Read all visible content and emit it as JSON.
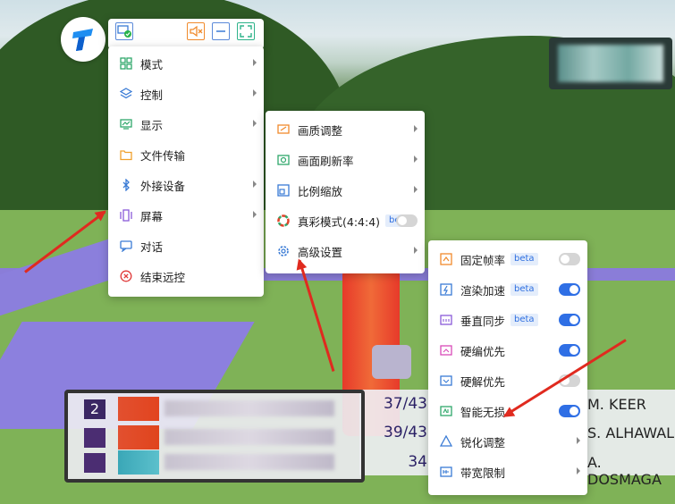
{
  "toolbar": {
    "icons": [
      "screen-check-icon",
      "mute-speaker-icon",
      "minimize-icon",
      "fullscreen-icon"
    ]
  },
  "main_menu": {
    "items": [
      {
        "label": "模式",
        "icon": "grid-icon",
        "submenu": true
      },
      {
        "label": "控制",
        "icon": "layers-icon",
        "submenu": true
      },
      {
        "label": "显示",
        "icon": "monitor-chart-icon",
        "submenu": true
      },
      {
        "label": "文件传输",
        "icon": "folder-icon",
        "submenu": false
      },
      {
        "label": "外接设备",
        "icon": "bluetooth-icon",
        "submenu": true
      },
      {
        "label": "屏幕",
        "icon": "screens-icon",
        "submenu": true
      },
      {
        "label": "对话",
        "icon": "chat-icon",
        "submenu": false
      },
      {
        "label": "结束远控",
        "icon": "close-circle-icon",
        "submenu": false
      }
    ]
  },
  "display_menu": {
    "items": [
      {
        "label": "画质调整",
        "icon": "image-quality-icon",
        "submenu": true
      },
      {
        "label": "画面刷新率",
        "icon": "refresh-rate-icon",
        "submenu": true
      },
      {
        "label": "比例缩放",
        "icon": "scale-icon",
        "submenu": true
      },
      {
        "label": "真彩模式(4:4:4)",
        "icon": "color-wheel-icon",
        "beta": "beta",
        "toggle": false
      },
      {
        "label": "高级设置",
        "icon": "gear-icon",
        "submenu": true
      }
    ]
  },
  "advanced_menu": {
    "items": [
      {
        "label": "固定帧率",
        "icon": "fixed-fps-icon",
        "beta": "beta",
        "toggle": false
      },
      {
        "label": "渲染加速",
        "icon": "render-boost-icon",
        "beta": "beta",
        "toggle": true
      },
      {
        "label": "垂直同步",
        "icon": "vsync-icon",
        "beta": "beta",
        "toggle": true
      },
      {
        "label": "硬编优先",
        "icon": "hw-encode-icon",
        "toggle": true
      },
      {
        "label": "硬解优先",
        "icon": "hw-decode-icon",
        "toggle": false
      },
      {
        "label": "智能无损",
        "icon": "smart-lossless-icon",
        "toggle": true
      },
      {
        "label": "锐化调整",
        "icon": "sharpen-triangle-icon",
        "submenu": true
      },
      {
        "label": "带宽限制",
        "icon": "bandwidth-icon",
        "submenu": true
      }
    ]
  },
  "scoreboard": {
    "rank_first": "2",
    "rows": [
      {
        "score": "37/43",
        "name": "M. KEER"
      },
      {
        "score": "39/43",
        "name": "S. ALHAWAL"
      },
      {
        "score": "34",
        "name": "A. DOSMAGA"
      }
    ]
  }
}
